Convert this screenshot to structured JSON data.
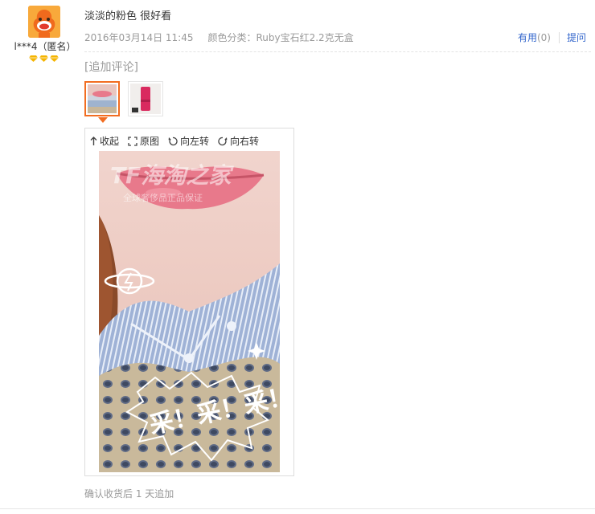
{
  "user": {
    "name": "l***4（匿名）",
    "level_gems": 3
  },
  "review": {
    "text": "淡淡的粉色 很好看",
    "date": "2016年03月14日 11:45",
    "sku": "颜色分类：Ruby宝石红2.2克无盒",
    "useful_label": "有用",
    "useful_count": "(0)",
    "ask_label": "提问"
  },
  "append": {
    "label": "[追加评论]"
  },
  "viewer": {
    "toolbar": {
      "collapse": "收起",
      "original": "原图",
      "rotate_left": "向左转",
      "rotate_right": "向右转"
    },
    "watermark_main": "TF海淘之家",
    "watermark_sub": "全球奢侈品正品保证",
    "sticker_text": "采！采！采！"
  },
  "footer": {
    "note": "确认收货后 1 天追加"
  },
  "colors": {
    "accent_orange": "#f26d21",
    "link_blue": "#3366cc",
    "muted_gray": "#999999",
    "gem_gold": "#f5b400"
  },
  "icons": [
    "avatar-character-icon",
    "diamond-icon",
    "collapse-arrow-icon",
    "fullscreen-icon",
    "rotate-left-icon",
    "rotate-right-icon"
  ]
}
